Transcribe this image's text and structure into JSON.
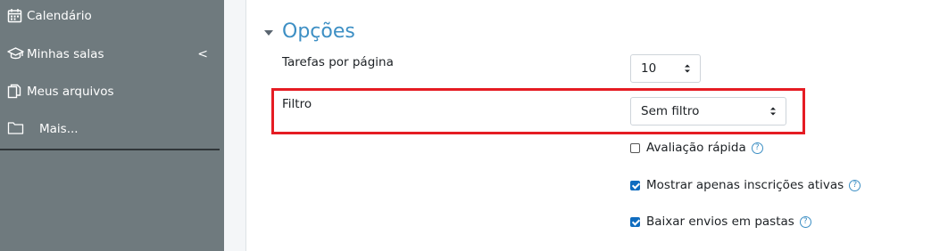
{
  "sidebar": {
    "items": [
      {
        "label": "Calendário",
        "icon": "calendar-icon"
      },
      {
        "label": "Minhas salas",
        "icon": "graduation-cap-icon",
        "chevron": "<"
      },
      {
        "label": "Meus arquivos",
        "icon": "files-icon"
      },
      {
        "label": "Mais...",
        "icon": "folder-icon"
      }
    ]
  },
  "options": {
    "title": "Opções",
    "tasks_per_page": {
      "label": "Tarefas por página",
      "value": "10"
    },
    "filter": {
      "label": "Filtro",
      "value": "Sem filtro"
    },
    "checkboxes": [
      {
        "label": "Avaliação rápida",
        "checked": false
      },
      {
        "label": "Mostrar apenas inscrições ativas",
        "checked": true
      },
      {
        "label": "Baixar envios em pastas",
        "checked": true
      }
    ],
    "help_glyph": "?"
  },
  "colors": {
    "sidebar_bg": "#6f7a7e",
    "accent": "#3d8fc4",
    "highlight": "#e51c23",
    "checkbox": "#0f6cbf"
  }
}
